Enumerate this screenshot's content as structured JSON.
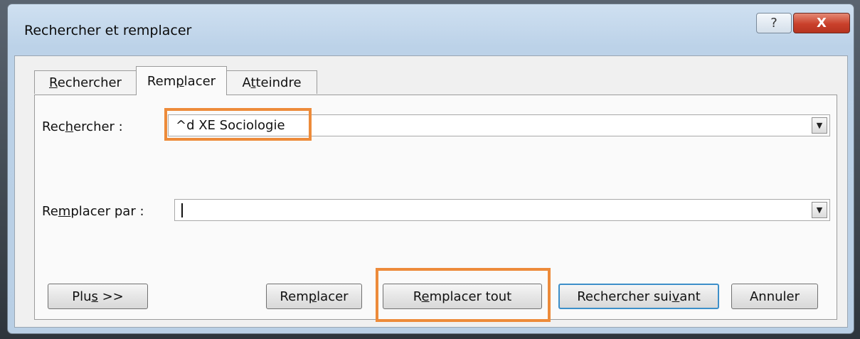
{
  "window": {
    "title": "Rechercher et remplacer"
  },
  "titlebar_buttons": {
    "help_icon": "?",
    "close_icon": "X"
  },
  "tabs": [
    {
      "pre": "",
      "u": "R",
      "post": "echercher"
    },
    {
      "pre": "Rem",
      "u": "p",
      "post": "lacer"
    },
    {
      "pre": "A",
      "u": "t",
      "post": "teindre"
    }
  ],
  "active_tab": "Remplacer",
  "find": {
    "label_pre": "Rec",
    "label_u": "h",
    "label_post": "ercher :",
    "value": "^d XE Sociologie"
  },
  "replace": {
    "label_pre": "Re",
    "label_u": "m",
    "label_post": "placer par :",
    "value": ""
  },
  "buttons": {
    "more": {
      "pre": "Plu",
      "u": "s",
      "post": " >>"
    },
    "replace": {
      "pre": "Rem",
      "u": "p",
      "post": "lacer"
    },
    "replace_all": {
      "pre": "R",
      "u": "e",
      "post": "mplacer tout"
    },
    "find_next": {
      "pre": "Rechercher sui",
      "u": "v",
      "post": "ant"
    },
    "cancel": "Annuler"
  },
  "colors": {
    "highlight": "#ed8b3a",
    "default_button_border": "#3d8fc9",
    "close_button": "#c9402b"
  }
}
